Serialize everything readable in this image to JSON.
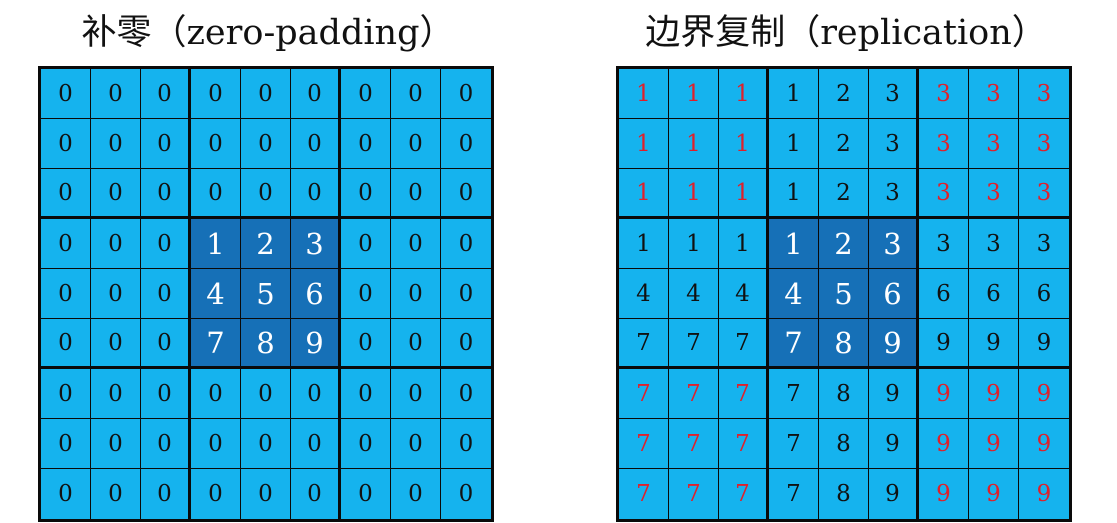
{
  "zero_padding": {
    "title": "补零（zero-padding）",
    "grid": [
      [
        "0",
        "0",
        "0",
        "0",
        "0",
        "0",
        "0",
        "0",
        "0"
      ],
      [
        "0",
        "0",
        "0",
        "0",
        "0",
        "0",
        "0",
        "0",
        "0"
      ],
      [
        "0",
        "0",
        "0",
        "0",
        "0",
        "0",
        "0",
        "0",
        "0"
      ],
      [
        "0",
        "0",
        "0",
        "1",
        "2",
        "3",
        "0",
        "0",
        "0"
      ],
      [
        "0",
        "0",
        "0",
        "4",
        "5",
        "6",
        "0",
        "0",
        "0"
      ],
      [
        "0",
        "0",
        "0",
        "7",
        "8",
        "9",
        "0",
        "0",
        "0"
      ],
      [
        "0",
        "0",
        "0",
        "0",
        "0",
        "0",
        "0",
        "0",
        "0"
      ],
      [
        "0",
        "0",
        "0",
        "0",
        "0",
        "0",
        "0",
        "0",
        "0"
      ],
      [
        "0",
        "0",
        "0",
        "0",
        "0",
        "0",
        "0",
        "0",
        "0"
      ]
    ]
  },
  "replication": {
    "title": "边界复制（replication）",
    "grid": [
      [
        "1",
        "1",
        "1",
        "1",
        "2",
        "3",
        "3",
        "3",
        "3"
      ],
      [
        "1",
        "1",
        "1",
        "1",
        "2",
        "3",
        "3",
        "3",
        "3"
      ],
      [
        "1",
        "1",
        "1",
        "1",
        "2",
        "3",
        "3",
        "3",
        "3"
      ],
      [
        "1",
        "1",
        "1",
        "1",
        "2",
        "3",
        "3",
        "3",
        "3"
      ],
      [
        "4",
        "4",
        "4",
        "4",
        "5",
        "6",
        "6",
        "6",
        "6"
      ],
      [
        "7",
        "7",
        "7",
        "7",
        "8",
        "9",
        "9",
        "9",
        "9"
      ],
      [
        "7",
        "7",
        "7",
        "7",
        "8",
        "9",
        "9",
        "9",
        "9"
      ],
      [
        "7",
        "7",
        "7",
        "7",
        "8",
        "9",
        "9",
        "9",
        "9"
      ],
      [
        "7",
        "7",
        "7",
        "7",
        "8",
        "9",
        "9",
        "9",
        "9"
      ]
    ]
  },
  "colors": {
    "cell_fill": "#15b3ee",
    "core_fill": "#1670b7",
    "core_text": "#ffffff",
    "corner_text": "#e0202a",
    "text": "#111111",
    "grid_line": "#0a0a0a"
  }
}
